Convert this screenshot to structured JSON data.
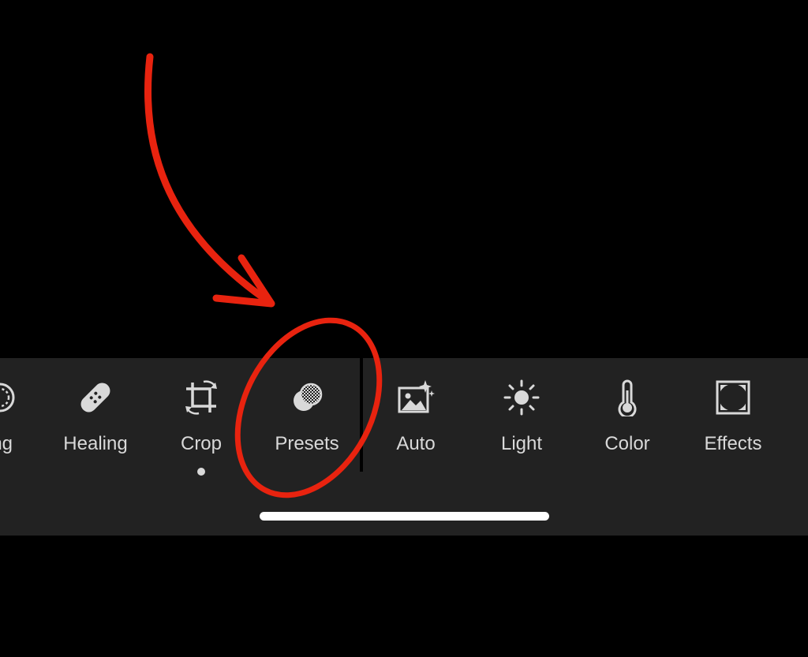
{
  "toolbar": {
    "accent_color": "#e8230f",
    "tools": [
      {
        "label": "ing",
        "icon": "masking-icon"
      },
      {
        "label": "Healing",
        "icon": "bandage-icon"
      },
      {
        "label": "Crop",
        "icon": "crop-rotate-icon",
        "active": true
      },
      {
        "label": "Presets",
        "icon": "presets-icon",
        "highlighted": true
      },
      {
        "label": "Auto",
        "icon": "auto-image-sparkle-icon"
      },
      {
        "label": "Light",
        "icon": "sun-icon"
      },
      {
        "label": "Color",
        "icon": "thermometer-icon"
      },
      {
        "label": "Effects",
        "icon": "vignette-frame-icon"
      }
    ]
  }
}
